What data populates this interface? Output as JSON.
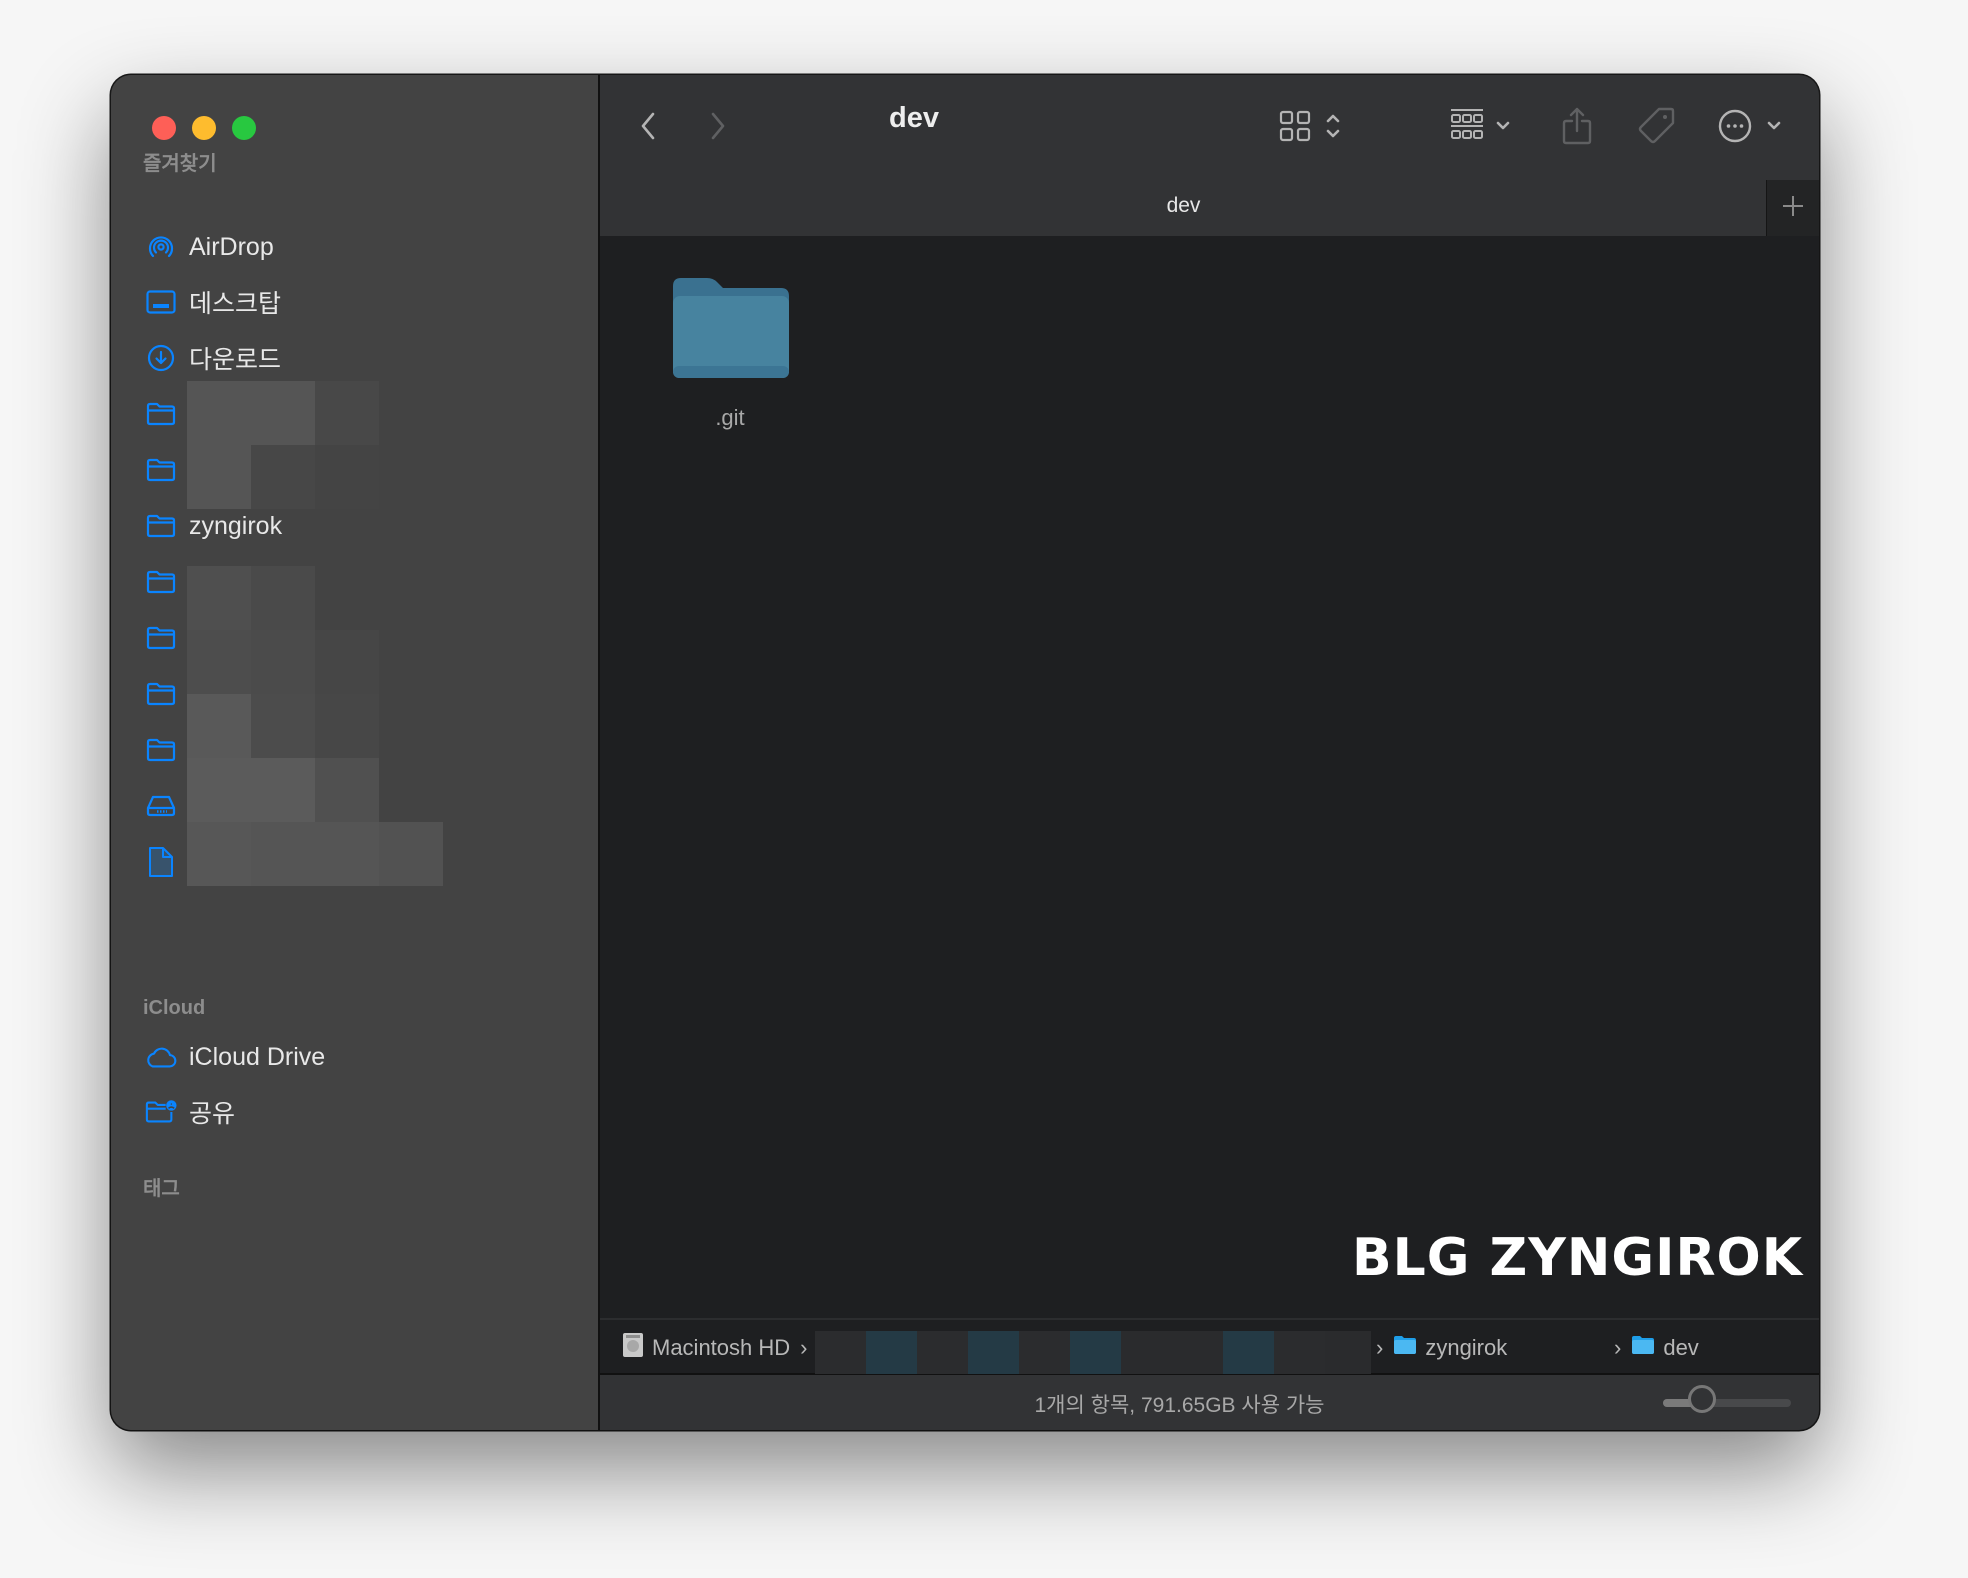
{
  "window": {
    "title": "dev",
    "traffic_lights": {
      "close": "#fe5f57",
      "minimize": "#febc2e",
      "maximize": "#28c840"
    }
  },
  "sidebar": {
    "accent": "#0a84ff",
    "sections": [
      {
        "header": "즐겨찾기",
        "items": [
          {
            "icon": "airdrop-icon",
            "label": "AirDrop"
          },
          {
            "icon": "desktop-icon",
            "label": "데스크탑"
          },
          {
            "icon": "download-icon",
            "label": "다운로드"
          },
          {
            "icon": "folder-icon",
            "label": ""
          },
          {
            "icon": "folder-icon",
            "label": ""
          },
          {
            "icon": "folder-icon",
            "label": "zyngirok"
          },
          {
            "icon": "folder-icon",
            "label": ""
          },
          {
            "icon": "folder-icon",
            "label": ""
          },
          {
            "icon": "folder-icon",
            "label": ""
          },
          {
            "icon": "folder-icon",
            "label": ""
          },
          {
            "icon": "drive-icon",
            "label": ""
          },
          {
            "icon": "document-icon",
            "label": ""
          }
        ]
      },
      {
        "header": "iCloud",
        "items": [
          {
            "icon": "cloud-icon",
            "label": "iCloud Drive"
          },
          {
            "icon": "shared-folder-icon",
            "label": "공유"
          }
        ]
      },
      {
        "header": "태그",
        "items": []
      }
    ]
  },
  "toolbar": {
    "title": "dev",
    "back": "chevron-left-icon",
    "forward": "chevron-right-icon",
    "view_mode": "grid-icon",
    "group": "group-icon",
    "share": "share-icon",
    "tags": "tag-icon",
    "more": "ellipsis-circle-icon",
    "search": "search-icon"
  },
  "tabbar": {
    "tabs": [
      {
        "label": "dev"
      }
    ],
    "add_label": "+"
  },
  "content": {
    "items": [
      {
        "name": ".git",
        "kind": "folder"
      }
    ],
    "watermark": "BLG ZYNGIROK"
  },
  "pathbar": {
    "segments": [
      {
        "label": "Macintosh HD",
        "icon": "hard-drive-icon"
      },
      {
        "label": "",
        "icon": "user-folder-icon"
      },
      {
        "label": "zyngirok",
        "icon": "folder-icon"
      },
      {
        "label": "dev",
        "icon": "folder-icon"
      }
    ],
    "separator": "›"
  },
  "statusbar": {
    "text": "1개의 항목, 791.65GB 사용 가능",
    "icon_size_slider": 0.25
  }
}
